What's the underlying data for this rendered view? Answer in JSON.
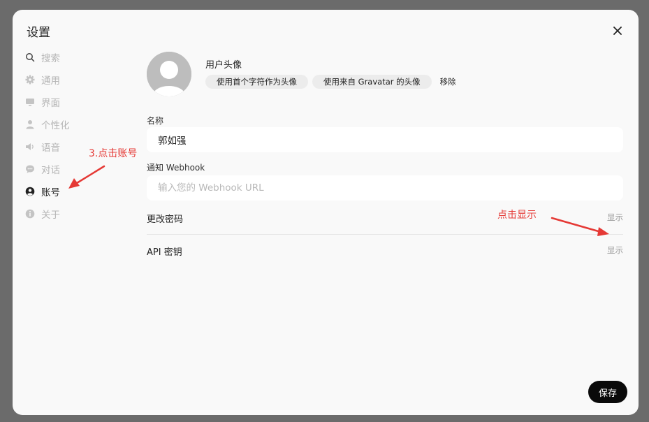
{
  "dialog": {
    "title": "设置",
    "save_label": "保存"
  },
  "sidebar": {
    "items": [
      {
        "label": "搜索",
        "icon": "search-icon"
      },
      {
        "label": "通用",
        "icon": "gear-icon"
      },
      {
        "label": "界面",
        "icon": "monitor-icon"
      },
      {
        "label": "个性化",
        "icon": "user-icon"
      },
      {
        "label": "语音",
        "icon": "speaker-icon"
      },
      {
        "label": "对话",
        "icon": "chat-icon"
      },
      {
        "label": "账号",
        "icon": "account-icon",
        "active": true
      },
      {
        "label": "关于",
        "icon": "info-icon"
      }
    ]
  },
  "account": {
    "avatar_label": "用户头像",
    "avatar_initials_button": "使用首个字符作为头像",
    "avatar_gravatar_button": "使用来自 Gravatar 的头像",
    "avatar_remove": "移除",
    "name_label": "名称",
    "name_value": "郭如强",
    "webhook_label": "通知 Webhook",
    "webhook_placeholder": "输入您的 Webhook URL",
    "password_label": "更改密码",
    "password_action": "显示",
    "api_label": "API 密钥",
    "api_action": "显示"
  },
  "annotations": {
    "left": "3.点击账号",
    "right": "点击显示",
    "color": "#e53935"
  }
}
